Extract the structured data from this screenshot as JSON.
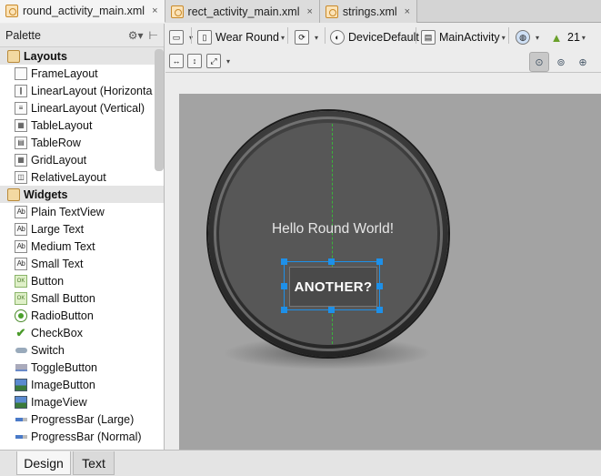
{
  "tabs": [
    {
      "label": "round_activity_main.xml",
      "close": "×"
    },
    {
      "label": "rect_activity_main.xml",
      "close": "×"
    },
    {
      "label": "strings.xml",
      "close": "×"
    }
  ],
  "palette": {
    "title": "Palette",
    "groups": [
      {
        "label": "Layouts",
        "items": [
          "FrameLayout",
          "LinearLayout (Horizonta",
          "LinearLayout (Vertical)",
          "TableLayout",
          "TableRow",
          "GridLayout",
          "RelativeLayout"
        ]
      },
      {
        "label": "Widgets",
        "items": [
          "Plain TextView",
          "Large Text",
          "Medium Text",
          "Small Text",
          "Button",
          "Small Button",
          "RadioButton",
          "CheckBox",
          "Switch",
          "ToggleButton",
          "ImageButton",
          "ImageView",
          "ProgressBar (Large)",
          "ProgressBar (Normal)"
        ]
      }
    ]
  },
  "toolbar": {
    "device": "Wear Round",
    "theme": "DeviceDefault",
    "activity": "MainActivity",
    "api": "21"
  },
  "preview": {
    "hello_text": "Hello Round World!",
    "button_text": "ANOTHER?"
  },
  "bottom_tabs": [
    "Design",
    "Text"
  ],
  "colors": {
    "selection": "#1e90e8",
    "guide": "#3ab43a",
    "canvas": "#a3a3a3"
  }
}
